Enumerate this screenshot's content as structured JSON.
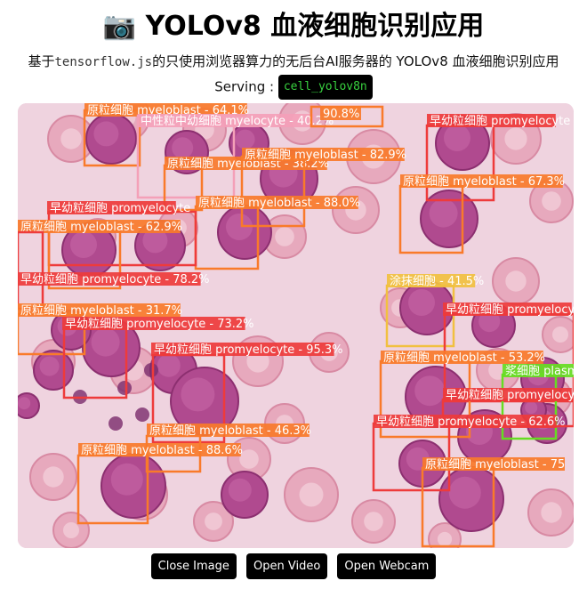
{
  "header": {
    "title_icon": "camera-icon",
    "title_icon_glyph": "📷",
    "title": "YOLOv8 血液细胞识别应用",
    "subtitle_prefix": "基于",
    "subtitle_lib": "tensorflow.js",
    "subtitle_suffix": "的只使用浏览器算力的无后台AI服务器的 YOLOv8 血液细胞识别应用",
    "serving_label": "Serving :",
    "model_name": "cell_yolov8n"
  },
  "colors": {
    "myeloblast": "#f97a2a",
    "promyelocyte": "#ee3b3b",
    "myelocyte": "#f4a0b8",
    "smudge": "#f1c040",
    "plasma": "#66dd22"
  },
  "detections": [
    {
      "label": "原粒细胞 myeloblast - 64.1%"
    },
    {
      "label": "中性粒中幼细胞 myelocyte - 40.2%"
    },
    {
      "label": "原粒细胞 myeloblast - 38.2%"
    },
    {
      "label": "原粒细胞 myeloblast - 82.9%"
    },
    {
      "label": "原粒细胞 myeloblast - 88.0%"
    },
    {
      "label": "早幼粒细胞 promyelocyte"
    },
    {
      "label": "原粒细胞 myeloblast - 62.9%"
    },
    {
      "label": "早幼粒细胞 promyelocyte - 78.2%"
    },
    {
      "label": "原粒细胞 myeloblast - 31.7%"
    },
    {
      "label": "早幼粒细胞 promyelocyte - 73.2%"
    },
    {
      "label": "早幼粒细胞 promyelocyte - 95.3%"
    },
    {
      "label": "原粒细胞 myeloblast - 46.3%"
    },
    {
      "label": "原粒细胞 myeloblast - 88.6%"
    },
    {
      "label": "早幼粒细胞 promyelocyte"
    },
    {
      "label": "原粒细胞 myeloblast - 67.3%"
    },
    {
      "label": "涂抹细胞 - 41.5%"
    },
    {
      "label": "早幼粒细胞 promyelocyte"
    },
    {
      "label": "原粒细胞 myeloblast - 53.2%"
    },
    {
      "label": "浆细胞 plasma"
    },
    {
      "label": "早幼粒细胞 promyelocyte"
    },
    {
      "label": "早幼粒细胞 promyelocyte - 62.6%"
    },
    {
      "label": "原粒细胞 myeloblast - 75"
    },
    {
      "label": "90.8%"
    }
  ],
  "controls": {
    "close_image": "Close Image",
    "open_video": "Open Video",
    "open_webcam": "Open Webcam"
  }
}
